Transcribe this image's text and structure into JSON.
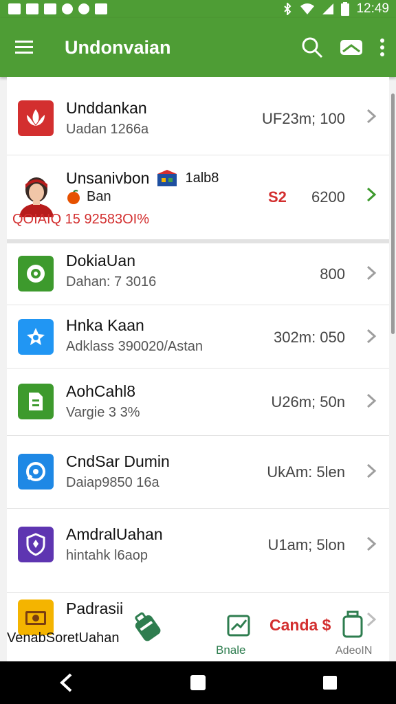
{
  "status": {
    "time": "12:49"
  },
  "app_bar": {
    "title": "Undonvaian",
    "colors": {
      "bar": "#4e9d35"
    }
  },
  "rows": [
    {
      "title": "Unddankan",
      "sub": "Uadan 1266a",
      "value": "UF23m; 100",
      "icon": "lotus-app-icon",
      "color": "#d32f2f"
    },
    {
      "title": "Unsanivbon",
      "tag": "1alb8",
      "sub": "Ban",
      "warning": "QOIAIQ 15 92583OI%",
      "badge": "S2",
      "value": "6200",
      "icon": "avatar",
      "chev_color": "#3d9a2d"
    },
    {
      "title": "DokiaUan",
      "sub": "Dahan: 7 3016",
      "value": "800",
      "icon": "chat-app-icon",
      "color": "#3d9a2d"
    },
    {
      "title": "Hnka Kaan",
      "sub": "Adklass 390020/Astan",
      "value": "302m: 050",
      "icon": "star-app-icon",
      "color": "#2196f3"
    },
    {
      "title": "AohCahl8",
      "sub": "Vargie 3 3%",
      "value": "U26m; 50n",
      "icon": "document-app-icon",
      "color": "#3d9a2d"
    },
    {
      "title": "CndSar Dumin",
      "sub": "Daiap9850 16a",
      "value": "UkAm: 5len",
      "icon": "target-app-icon",
      "color": "#1e88e5"
    },
    {
      "title": "AmdralUahan",
      "sub": "hintahk l6aop",
      "value": "U1am; 5lon",
      "icon": "shield-app-icon",
      "color": "#5e35b1"
    },
    {
      "title": "Padrasii",
      "sub": "VenabSoretUahan",
      "icon": "gift-app-icon",
      "color": "#f4b400"
    }
  ],
  "bottom_actions": {
    "mid_label": "Bnale",
    "red_label": "Canda $",
    "right_label": "AdeoIN"
  }
}
